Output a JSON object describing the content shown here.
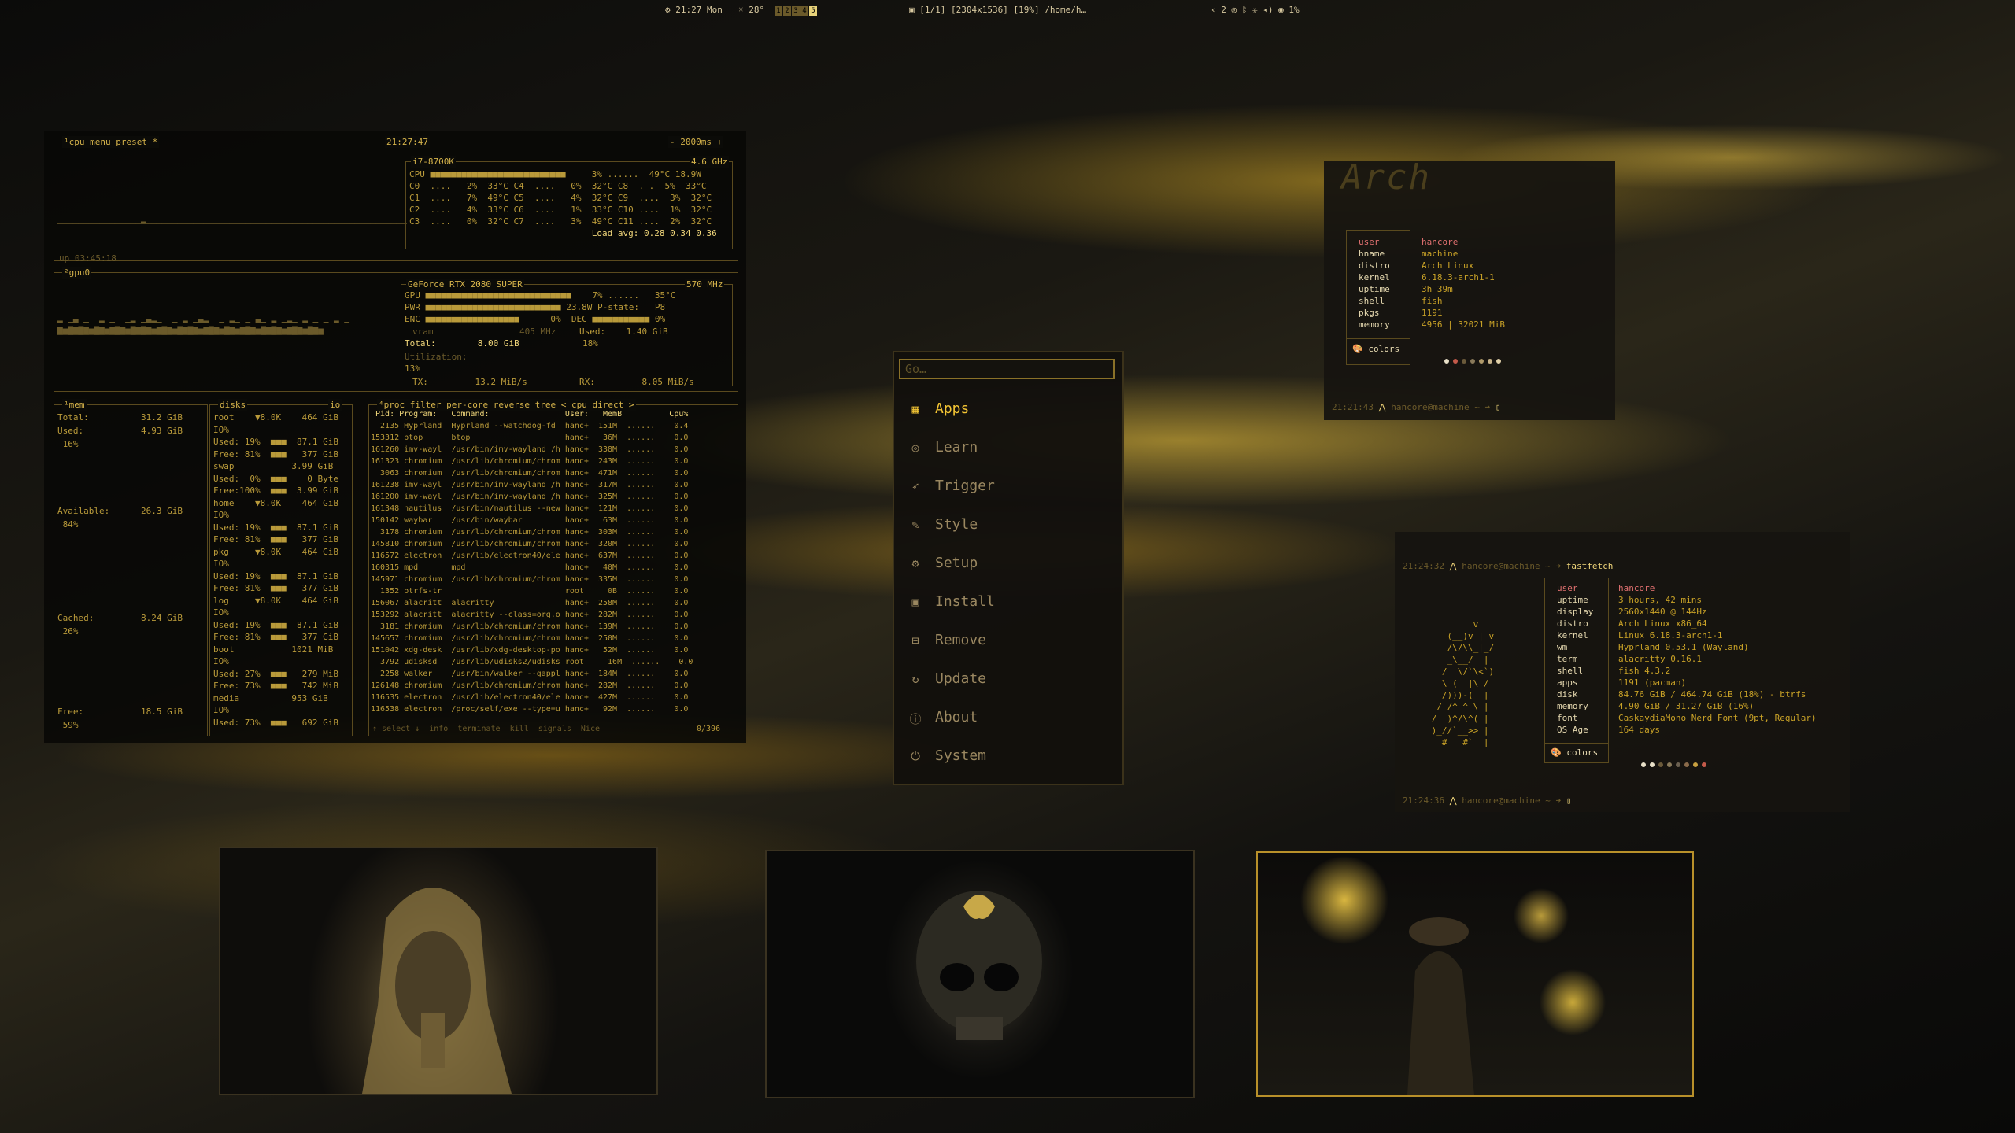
{
  "topbar": {
    "clock": "21:27 Mon",
    "temp": "28°",
    "workspaces": [
      "1",
      "2",
      "3",
      "4",
      "5"
    ],
    "active_workspace": "5",
    "window_title": "[1/1] [2304x1536] [19%] /home/h…",
    "tray_count": "2",
    "battery": "1%"
  },
  "btop": {
    "cpu_header": "¹cpu  menu  preset *",
    "clock": "21:27:47",
    "interval": "- 2000ms +",
    "uptime": "up 03:45:18",
    "cpu_model": "i7-8700K",
    "cpu_freq": "4.6 GHz",
    "cpu_lines": [
      "CPU ■■■■■■■■■■■■■■■■■■■■■■■■■■     3% ......  49°C 18.9W",
      "C0  ....   2%  33°C C4  ....   0%  32°C C8  . .  5%  33°C",
      "C1  ....   7%  49°C C5  ....   4%  32°C C9  ....  3%  32°C",
      "C2  ....   4%  33°C C6  ....   1%  33°C C10 ....  1%  32°C",
      "C3  ....   0%  32°C C7  ....   3%  49°C C11 ....  2%  32°C",
      "                                   Load avg: 0.28 0.34 0.36"
    ],
    "gpu_header": "²gpu0",
    "gpu_model": "GeForce RTX 2080 SUPER",
    "gpu_freq": "570 MHz",
    "gpu_lines": [
      "GPU ■■■■■■■■■■■■■■■■■■■■■■■■■■■■    7% ......   35°C",
      "PWR ■■■■■■■■■■■■■■■■■■■■■■■■■■ 23.8W P-state:   P8",
      "ENC ■■■■■■■■■■■■■■■■■■      0%  DEC ■■■■■■■■■■■ 0%"
    ],
    "vram_label": "vram",
    "vram_freq": "405 MHz",
    "vram_total": "Total:        8.00 GiB",
    "vram_used": "Used:    1.40 GiB",
    "vram_used_pct": "18%",
    "utilization_label": "Utilization:",
    "utilization_val": "13%",
    "tx": "TX:         13.2 MiB/s",
    "rx": "RX:         8.05 MiB/s",
    "mem_header": "¹mem",
    "mem_lines": [
      "Total:          31.2 GiB",
      "Used:           4.93 GiB",
      " 16%",
      "",
      "",
      "",
      "",
      "Available:      26.3 GiB",
      " 84%",
      "",
      "",
      "",
      "",
      "",
      "",
      "Cached:         8.24 GiB",
      " 26%",
      "",
      "",
      "",
      "",
      "",
      "Free:           18.5 GiB",
      " 59%"
    ],
    "disks_header": "disks",
    "io_label": "io",
    "disk_lines": [
      "root    ▼8.0K    464 GiB",
      "IO%",
      "Used: 19%  ■■■  87.1 GiB",
      "Free: 81%  ■■■   377 GiB",
      "swap           3.99 GiB",
      "Used:  0%  ■■■    0 Byte",
      "Free:100%  ■■■  3.99 GiB",
      "home    ▼8.0K    464 GiB",
      "IO%",
      "Used: 19%  ■■■  87.1 GiB",
      "Free: 81%  ■■■   377 GiB",
      "pkg     ▼8.0K    464 GiB",
      "IO%",
      "Used: 19%  ■■■  87.1 GiB",
      "Free: 81%  ■■■   377 GiB",
      "log     ▼8.0K    464 GiB",
      "IO%",
      "Used: 19%  ■■■  87.1 GiB",
      "Free: 81%  ■■■   377 GiB",
      "boot           1021 MiB",
      "IO%",
      "Used: 27%  ■■■   279 MiB",
      "Free: 73%  ■■■   742 MiB",
      "media          953 GiB",
      "IO%",
      "Used: 73%  ■■■   692 GiB"
    ],
    "proc_header": "⁴proc  filter          per-core  reverse  tree  < cpu direct >",
    "proc_columns": " Pid: Program:   Command:                User:   MemB          Cpu%",
    "proc_rows": [
      "  2135 Hyprland  Hyprland --watchdog-fd  hanc+  151M  ......    0.4",
      "153312 btop      btop                    hanc+   36M  ......    0.0",
      "161260 imv-wayl  /usr/bin/imv-wayland /h hanc+  338M  ......    0.0",
      "161323 chromium  /usr/lib/chromium/chrom hanc+  243M  ......    0.0",
      "  3063 chromium  /usr/lib/chromium/chrom hanc+  471M  ......    0.0",
      "161238 imv-wayl  /usr/bin/imv-wayland /h hanc+  317M  ......    0.0",
      "161200 imv-wayl  /usr/bin/imv-wayland /h hanc+  325M  ......    0.0",
      "161348 nautilus  /usr/bin/nautilus --new hanc+  121M  ......    0.0",
      "150142 waybar    /usr/bin/waybar         hanc+   63M  ......    0.0",
      "  3178 chromium  /usr/lib/chromium/chrom hanc+  303M  ......    0.0",
      "145810 chromium  /usr/lib/chromium/chrom hanc+  320M  ......    0.0",
      "116572 electron  /usr/lib/electron40/ele hanc+  637M  ......    0.0",
      "160315 mpd       mpd                     hanc+   40M  ......    0.0",
      "145971 chromium  /usr/lib/chromium/chrom hanc+  335M  ......    0.0",
      "  1352 btrfs-tr                          root     0B  ......    0.0",
      "156067 alacritt  alacritty               hanc+  258M  ......    0.0",
      "153292 alacritt  alacritty --class=org.o hanc+  282M  ......    0.0",
      "  3181 chromium  /usr/lib/chromium/chrom hanc+  139M  ......    0.0",
      "145657 chromium  /usr/lib/chromium/chrom hanc+  250M  ......    0.0",
      "151042 xdg-desk  /usr/lib/xdg-desktop-po hanc+   52M  ......    0.0",
      "  3792 udisksd   /usr/lib/udisks2/udisks root     16M  ......    0.0",
      "  2258 walker    /usr/bin/walker --gappl hanc+  184M  ......    0.0",
      "126148 chromium  /usr/lib/chromium/chrom hanc+  282M  ......    0.0",
      "116535 electron  /usr/lib/electron40/ele hanc+  427M  ......    0.0",
      "116538 electron  /proc/self/exe --type=u hanc+   92M  ......    0.0"
    ],
    "proc_footer": "↑ select ↓  info  terminate  kill  signals  Nice",
    "proc_count": "0/396"
  },
  "launcher": {
    "placeholder": "Go…",
    "items": [
      {
        "label": "Apps",
        "icon": "grid-icon",
        "glyph": "▦"
      },
      {
        "label": "Learn",
        "icon": "book-icon",
        "glyph": "◎"
      },
      {
        "label": "Trigger",
        "icon": "rocket-icon",
        "glyph": "➶"
      },
      {
        "label": "Style",
        "icon": "brush-icon",
        "glyph": "✎"
      },
      {
        "label": "Setup",
        "icon": "gear-icon",
        "glyph": "⚙"
      },
      {
        "label": "Install",
        "icon": "package-icon",
        "glyph": "▣"
      },
      {
        "label": "Remove",
        "icon": "trash-icon",
        "glyph": "⊟"
      },
      {
        "label": "Update",
        "icon": "refresh-icon",
        "glyph": "↻"
      },
      {
        "label": "About",
        "icon": "info-icon",
        "glyph": "ⓘ"
      },
      {
        "label": "System",
        "icon": "power-icon",
        "glyph": "⏻"
      }
    ]
  },
  "fetch1": {
    "logo": "Arch",
    "keys": [
      "user",
      "hname",
      "distro",
      "kernel",
      "uptime",
      "shell",
      "pkgs",
      "memory"
    ],
    "values": [
      "hancore",
      "machine",
      "Arch Linux",
      "6.18.3-arch1-1",
      "3h 39m",
      "fish",
      "1191",
      "4956 | 32021 MiB"
    ],
    "colors_label": "colors",
    "prompt": "21:21:43",
    "prompt_user": "hancore@machine ~ ➜"
  },
  "fetch2": {
    "prompt_time": "21:24:32",
    "prompt_user": "hancore@machine ~ ➜",
    "command": "fastfetch",
    "ascii": [
      "         v",
      "    (__)v | v",
      "    /\\/\\\\_|_/",
      "    _\\__/  |",
      "   /  \\/`\\<`)",
      "   \\ (  |\\_/",
      "   /)))-(  |",
      "  / /^ ^ \\ |",
      " /  )^/\\^( |",
      " )_//`__>> |",
      "   #   #`  |"
    ],
    "keys": [
      "user",
      "uptime",
      "display",
      "distro",
      "kernel",
      "wm",
      "term",
      "shell",
      "apps",
      "disk",
      "memory",
      "font",
      "OS Age"
    ],
    "values": [
      "hancore",
      "3 hours, 42 mins",
      "2560x1440 @ 144Hz",
      "Arch Linux x86_64",
      "Linux 6.18.3-arch1-1",
      "Hyprland 0.53.1 (Wayland)",
      "alacritty 0.16.1",
      "fish 4.3.2",
      "1191 (pacman)",
      "84.76 GiB / 464.74 GiB (18%) - btrfs",
      "4.90 GiB / 31.27 GiB (16%)",
      "CaskaydiaMono Nerd Font (9pt, Regular)",
      "164 days"
    ],
    "colors_label": "colors",
    "prompt_time2": "21:24:36"
  },
  "colors": {
    "accent": "#f3c534",
    "panel": "#16140f",
    "border": "#5a4a1e"
  }
}
